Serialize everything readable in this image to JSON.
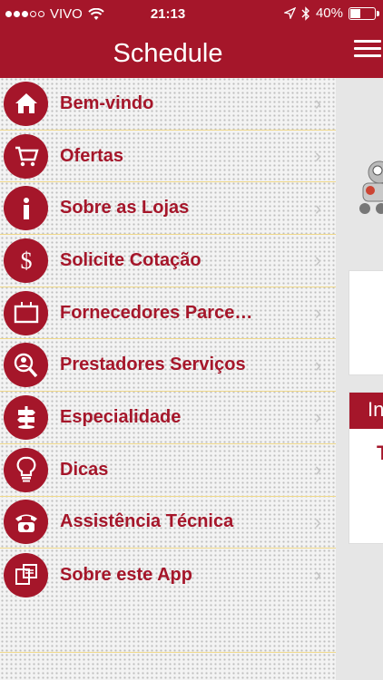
{
  "status": {
    "carrier": "VIVO",
    "time": "21:13",
    "battery": "40%",
    "battery_level": 0.4
  },
  "header": {
    "title": "Schedule"
  },
  "menu": {
    "items": [
      {
        "label": "Bem-vindo",
        "icon": "home-icon"
      },
      {
        "label": "Ofertas",
        "icon": "cart-icon"
      },
      {
        "label": "Sobre as Lojas",
        "icon": "info-icon"
      },
      {
        "label": "Solicite Cotação",
        "icon": "dollar-icon"
      },
      {
        "label": "Fornecedores Parce…",
        "icon": "tv-icon"
      },
      {
        "label": "Prestadores Serviços",
        "icon": "search-person-icon"
      },
      {
        "label": "Especialidade",
        "icon": "signpost-icon"
      },
      {
        "label": "Dicas",
        "icon": "lightbulb-icon"
      },
      {
        "label": "Assistência Técnica",
        "icon": "telephone-icon"
      },
      {
        "label": "Sobre este App",
        "icon": "app-icon"
      }
    ]
  },
  "main": {
    "card_header": "In",
    "card_text": "T"
  },
  "colors": {
    "brand": "#a5162a",
    "divider": "#f0d98a"
  }
}
